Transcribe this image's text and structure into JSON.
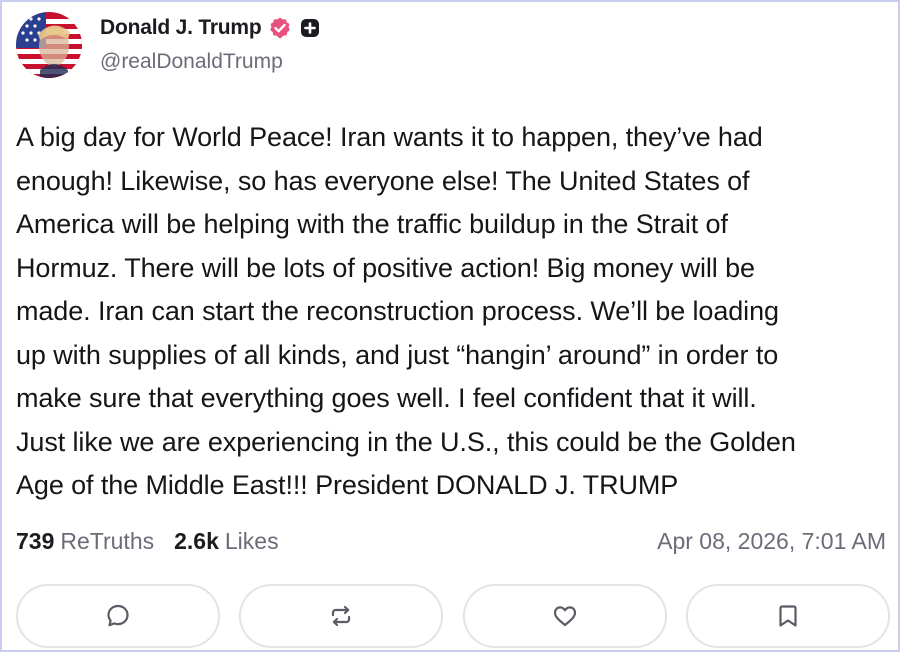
{
  "author": {
    "name": "Donald J. Trump",
    "handle": "@realDonaldTrump",
    "avatar": "flag-portrait-avatar",
    "verified_icon": "verified-badge-icon",
    "plus_icon": "plus-badge-icon"
  },
  "post": {
    "lines": [
      "A big day for World Peace! Iran wants it to happen, they’ve had",
      "enough! Likewise, so has everyone else! The United States of",
      "America will be helping with the traffic buildup in the Strait of",
      "Hormuz. There will be lots of positive action! Big money will be",
      "made. Iran can start the reconstruction process. We’ll be loading",
      "up with supplies of all kinds, and just “hangin’ around” in order to",
      "make sure that everything goes well. I feel confident that it will.",
      "Just like we are experiencing in the U.S., this could be the Golden",
      "Age of the Middle East!!! President DONALD J. TRUMP"
    ]
  },
  "stats": {
    "retruths_count": "739",
    "retruths_label": "ReTruths",
    "likes_count": "2.6k",
    "likes_label": "Likes"
  },
  "timestamp": "Apr 08, 2026, 7:01 AM",
  "actions": [
    {
      "name": "reply",
      "icon": "comment-icon"
    },
    {
      "name": "retruth",
      "icon": "retruth-icon"
    },
    {
      "name": "like",
      "icon": "heart-icon"
    },
    {
      "name": "bookmark",
      "icon": "bookmark-icon"
    }
  ],
  "colors": {
    "verified": "#e8517f",
    "frame_border": "#c9cbef",
    "muted_text": "#6c6c78",
    "icon_stroke": "#5b5b66"
  }
}
